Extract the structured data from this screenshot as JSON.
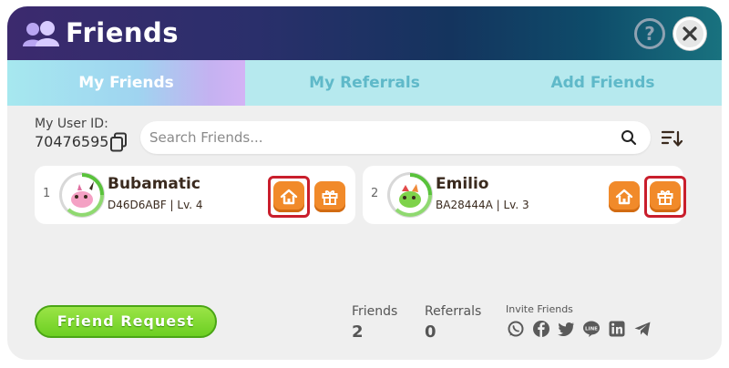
{
  "window": {
    "title": "Friends"
  },
  "tabs": [
    {
      "label": "My Friends",
      "active": true
    },
    {
      "label": "My Referrals",
      "active": false
    },
    {
      "label": "Add Friends",
      "active": false
    }
  ],
  "user": {
    "id_label": "My User ID:",
    "id_value": "70476595"
  },
  "search": {
    "placeholder": "Search Friends..."
  },
  "friends": [
    {
      "rank": "1",
      "name": "Bubamatic",
      "meta": "D46D6ABF | Lv. 4"
    },
    {
      "rank": "2",
      "name": "Emilio",
      "meta": "BA28444A | Lv. 3"
    }
  ],
  "footer": {
    "request_button": "Friend Request",
    "friends_label": "Friends",
    "friends_count": "2",
    "referrals_label": "Referrals",
    "referrals_count": "0",
    "invite_label": "Invite Friends"
  },
  "colors": {
    "action_orange": "#f18a2a",
    "highlight_red": "#c91e2c",
    "request_green": "#6ccf22",
    "tab_inactive_text": "#5fb9c9"
  },
  "icons": {
    "social": [
      "whatsapp-icon",
      "facebook-icon",
      "twitter-icon",
      "line-icon",
      "linkedin-icon",
      "telegram-icon"
    ]
  }
}
